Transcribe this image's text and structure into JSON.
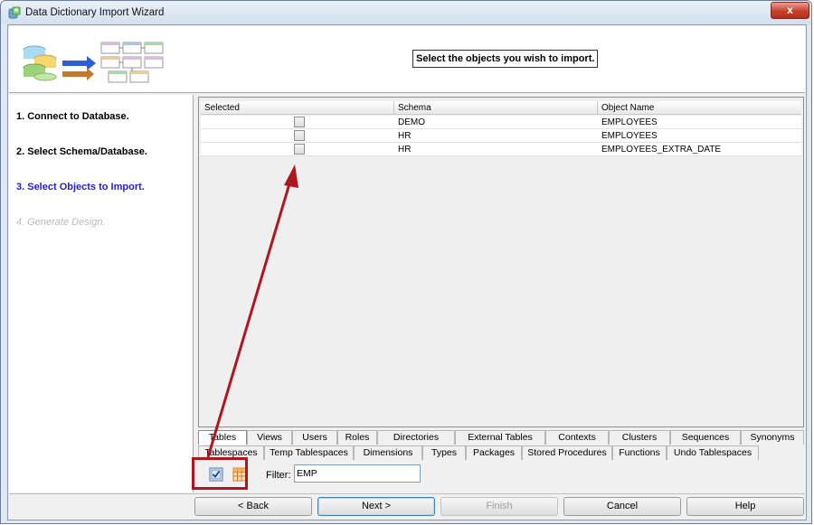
{
  "window": {
    "title": "Data Dictionary Import Wizard",
    "close_label": "x"
  },
  "header": {
    "instruction": "Select the objects you wish to import."
  },
  "steps": [
    {
      "label": "1. Connect to Database.",
      "state": "done"
    },
    {
      "label": "2. Select Schema/Database.",
      "state": "done"
    },
    {
      "label": "3. Select Objects to Import.",
      "state": "current"
    },
    {
      "label": "4. Generate Design.",
      "state": "disabled"
    }
  ],
  "table": {
    "columns": [
      "Selected",
      "Schema",
      "Object Name"
    ],
    "rows": [
      {
        "selected": false,
        "schema": "DEMO",
        "object_name": "EMPLOYEES"
      },
      {
        "selected": false,
        "schema": "HR",
        "object_name": "EMPLOYEES"
      },
      {
        "selected": false,
        "schema": "HR",
        "object_name": "EMPLOYEES_EXTRA_DATE"
      }
    ]
  },
  "tabs_row1": [
    "Tables",
    "Views",
    "Users",
    "Roles",
    "Directories",
    "External Tables",
    "Contexts",
    "Clusters",
    "Sequences",
    "Synonyms"
  ],
  "tabs_row2": [
    "Tablespaces",
    "Temp Tablespaces",
    "Dimensions",
    "Types",
    "Packages",
    "Stored Procedures",
    "Functions",
    "Undo Tablespaces"
  ],
  "active_tab": "Tables",
  "filter": {
    "label": "Filter:",
    "value": "EMP"
  },
  "buttons": {
    "back": "< Back",
    "next": "Next >",
    "finish": "Finish",
    "cancel": "Cancel",
    "help": "Help"
  },
  "colors": {
    "annotation": "#b0161e",
    "current_step": "#2222cc",
    "disabled_step": "#b9b9b9"
  },
  "icons": {
    "select_all": "checklist-icon",
    "deselect_all": "table-grid-icon",
    "app": "data-import-icon"
  }
}
